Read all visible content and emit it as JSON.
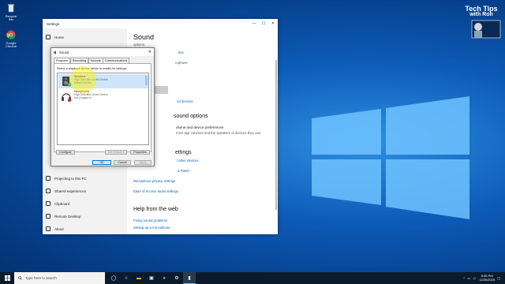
{
  "desktop": {
    "icons": [
      {
        "label": "Recycle Bin",
        "icon": "recycle-bin-icon"
      },
      {
        "label": "Google Chrome",
        "icon": "chrome-icon"
      }
    ],
    "watermark": {
      "line1": "Tech Tips",
      "line2": "with Ron"
    }
  },
  "settings": {
    "title": "Settings",
    "window_controls": [
      "—",
      "☐",
      "✕"
    ],
    "nav": {
      "home": "Home",
      "items": [
        "Projecting to this PC",
        "Shared experiences",
        "Clipboard",
        "Remote Desktop",
        "About"
      ]
    },
    "main": {
      "heading": "Sound",
      "output_label": "options",
      "link_fragment": "ties",
      "microphone_fragment": "rophone",
      "troubleshoot_label": "shoot",
      "manage_devices": "nd devices",
      "advanced_heading": "sound options",
      "app_volume_title": "olume and device preferences",
      "app_volume_desc": "mize app volumes and the speakers or devices they use.",
      "related_heading": "ettings",
      "related_links": [
        "l other devices",
        "d Panel",
        "Microphone privacy settings",
        "Ease of Access audio settings"
      ],
      "help_heading": "Help from the web",
      "help_links": [
        "Fixing sound problems",
        "Setting up a microphone"
      ]
    }
  },
  "sound_dialog": {
    "title": "Sound",
    "close": "✕",
    "tabs": [
      "Playback",
      "Recording",
      "Sounds",
      "Communications"
    ],
    "active_tab": "Playback",
    "instruction": "Select a playback device below to modify its settings:",
    "devices": [
      {
        "name": "Speakers",
        "desc": "High Definition Audio Device",
        "status": "Default Device",
        "selected": true
      },
      {
        "name": "Headphones",
        "desc": "High Definition Audio Device",
        "status": "Not plugged in",
        "selected": false
      }
    ],
    "buttons": {
      "configure": "Configure",
      "set_default": "Set Default ▾",
      "properties": "Properties",
      "ok": "OK",
      "cancel": "Cancel",
      "apply": "Apply"
    }
  },
  "taskbar": {
    "search_placeholder": "Type here to search",
    "apps": [
      "task-view-icon",
      "edge-icon",
      "file-explorer-icon",
      "store-icon",
      "chrome-icon",
      "settings-icon",
      "sound-icon"
    ],
    "time": "8:46 PM",
    "date": "12/26/2020"
  },
  "colors": {
    "accent": "#0078d7",
    "link": "#0066b4",
    "taskbar": "#0b1b2e"
  }
}
